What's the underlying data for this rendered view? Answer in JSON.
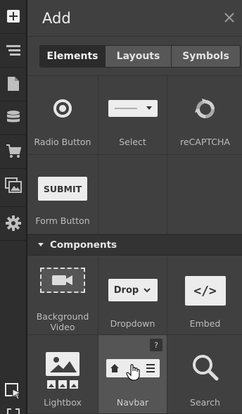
{
  "rail": {
    "icons": [
      "plus-icon",
      "navigator-icon",
      "pages-icon",
      "cms-icon",
      "ecommerce-icon",
      "assets-icon",
      "settings-icon",
      "select-tool-icon"
    ]
  },
  "panel": {
    "title": "Add",
    "close_icon": "close-icon"
  },
  "tabs": [
    {
      "label": "Elements",
      "active": true
    },
    {
      "label": "Layouts",
      "active": false
    },
    {
      "label": "Symbols",
      "active": false
    }
  ],
  "forms": {
    "items": [
      {
        "label": "Radio Button",
        "icon": "radio-button-icon"
      },
      {
        "label": "Select",
        "icon": "select-icon"
      },
      {
        "label": "reCAPTCHA",
        "icon": "recaptcha-icon"
      },
      {
        "label": "Form Button",
        "icon": "form-button-icon",
        "button_text": "SUBMIT"
      }
    ]
  },
  "components": {
    "title": "Components",
    "items": [
      {
        "label": "Background Video",
        "icon": "background-video-icon"
      },
      {
        "label": "Dropdown",
        "icon": "dropdown-icon",
        "button_text": "Drop"
      },
      {
        "label": "Embed",
        "icon": "embed-icon",
        "code_text": "</>"
      },
      {
        "label": "Lightbox",
        "icon": "lightbox-icon"
      },
      {
        "label": "Navbar",
        "icon": "navbar-icon",
        "help_text": "?"
      },
      {
        "label": "Search",
        "icon": "search-icon"
      }
    ]
  },
  "colors": {
    "rail_bg": "#2e2e2e",
    "panel_bg": "#404040",
    "active_tab_bg": "#2b2b2b",
    "hover_cell_bg": "#555555"
  }
}
